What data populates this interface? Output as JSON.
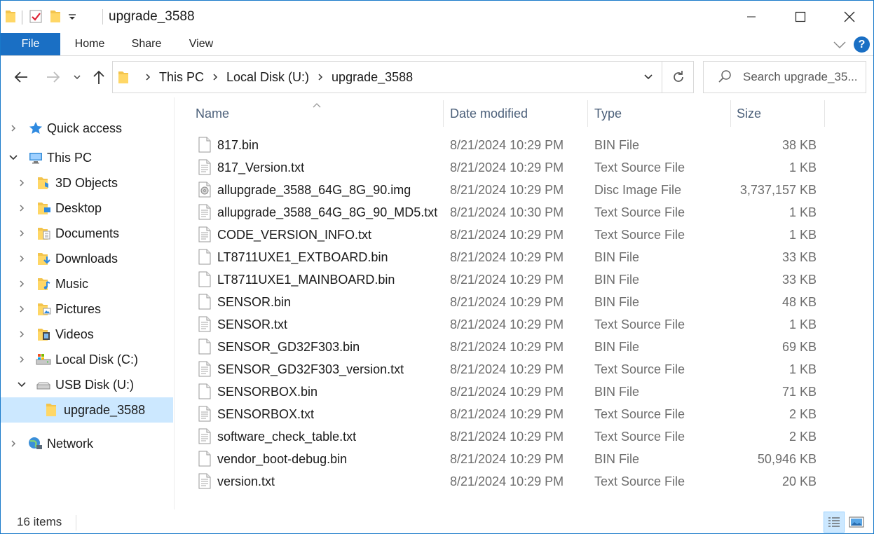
{
  "window": {
    "title": "upgrade_3588",
    "controls": [
      "minimize-icon",
      "maximize-icon",
      "close-icon"
    ]
  },
  "ribbon": {
    "tabs": [
      "File",
      "Home",
      "Share",
      "View"
    ],
    "help_label": "?",
    "accent": "#1a6fc4"
  },
  "address": {
    "breadcrumbs": [
      "This PC",
      "Local Disk (U:)",
      "upgrade_3588"
    ]
  },
  "search": {
    "placeholder": "Search upgrade_35..."
  },
  "sidebar": {
    "items": [
      {
        "label": "Quick access",
        "icon": "star-icon",
        "level": 0,
        "expanded": false
      },
      {
        "label": "This PC",
        "icon": "computer-icon",
        "level": 0,
        "expanded": true
      },
      {
        "label": "3D Objects",
        "icon": "folder-3d-icon",
        "level": 1,
        "expanded": false
      },
      {
        "label": "Desktop",
        "icon": "folder-desktop-icon",
        "level": 1,
        "expanded": false
      },
      {
        "label": "Documents",
        "icon": "folder-documents-icon",
        "level": 1,
        "expanded": false
      },
      {
        "label": "Downloads",
        "icon": "folder-downloads-icon",
        "level": 1,
        "expanded": false
      },
      {
        "label": "Music",
        "icon": "folder-music-icon",
        "level": 1,
        "expanded": false
      },
      {
        "label": "Pictures",
        "icon": "folder-pictures-icon",
        "level": 1,
        "expanded": false
      },
      {
        "label": "Videos",
        "icon": "folder-videos-icon",
        "level": 1,
        "expanded": false
      },
      {
        "label": "Local Disk (C:)",
        "icon": "drive-icon",
        "level": 1,
        "expanded": false
      },
      {
        "label": "USB Disk  (U:)",
        "icon": "usb-drive-icon",
        "level": 1,
        "expanded": true
      },
      {
        "label": "upgrade_3588",
        "icon": "folder-icon",
        "level": 2,
        "selected": true
      },
      {
        "label": "Network",
        "icon": "network-icon",
        "level": 0,
        "expanded": false
      }
    ]
  },
  "columns": [
    "Name",
    "Date modified",
    "Type",
    "Size"
  ],
  "files": [
    {
      "name": "817.bin",
      "date": "8/21/2024 10:29 PM",
      "type": "BIN File",
      "size": "38 KB",
      "icon": "bin-file-icon"
    },
    {
      "name": "817_Version.txt",
      "date": "8/21/2024 10:29 PM",
      "type": "Text Source File",
      "size": "1 KB",
      "icon": "text-file-icon"
    },
    {
      "name": "allupgrade_3588_64G_8G_90.img",
      "date": "8/21/2024 10:29 PM",
      "type": "Disc Image File",
      "size": "3,737,157 KB",
      "icon": "disc-image-icon"
    },
    {
      "name": "allupgrade_3588_64G_8G_90_MD5.txt",
      "date": "8/21/2024 10:30 PM",
      "type": "Text Source File",
      "size": "1 KB",
      "icon": "text-file-icon"
    },
    {
      "name": "CODE_VERSION_INFO.txt",
      "date": "8/21/2024 10:29 PM",
      "type": "Text Source File",
      "size": "1 KB",
      "icon": "text-file-icon"
    },
    {
      "name": "LT8711UXE1_EXTBOARD.bin",
      "date": "8/21/2024 10:29 PM",
      "type": "BIN File",
      "size": "33 KB",
      "icon": "bin-file-icon"
    },
    {
      "name": "LT8711UXE1_MAINBOARD.bin",
      "date": "8/21/2024 10:29 PM",
      "type": "BIN File",
      "size": "33 KB",
      "icon": "bin-file-icon"
    },
    {
      "name": "SENSOR.bin",
      "date": "8/21/2024 10:29 PM",
      "type": "BIN File",
      "size": "48 KB",
      "icon": "bin-file-icon"
    },
    {
      "name": "SENSOR.txt",
      "date": "8/21/2024 10:29 PM",
      "type": "Text Source File",
      "size": "1 KB",
      "icon": "text-file-icon"
    },
    {
      "name": "SENSOR_GD32F303.bin",
      "date": "8/21/2024 10:29 PM",
      "type": "BIN File",
      "size": "69 KB",
      "icon": "bin-file-icon"
    },
    {
      "name": "SENSOR_GD32F303_version.txt",
      "date": "8/21/2024 10:29 PM",
      "type": "Text Source File",
      "size": "1 KB",
      "icon": "text-file-icon"
    },
    {
      "name": "SENSORBOX.bin",
      "date": "8/21/2024 10:29 PM",
      "type": "BIN File",
      "size": "71 KB",
      "icon": "bin-file-icon"
    },
    {
      "name": "SENSORBOX.txt",
      "date": "8/21/2024 10:29 PM",
      "type": "Text Source File",
      "size": "2 KB",
      "icon": "text-file-icon"
    },
    {
      "name": "software_check_table.txt",
      "date": "8/21/2024 10:29 PM",
      "type": "Text Source File",
      "size": "2 KB",
      "icon": "text-file-icon"
    },
    {
      "name": "vendor_boot-debug.bin",
      "date": "8/21/2024 10:29 PM",
      "type": "BIN File",
      "size": "50,946 KB",
      "icon": "bin-file-icon"
    },
    {
      "name": "version.txt",
      "date": "8/21/2024 10:29 PM",
      "type": "Text Source File",
      "size": "20 KB",
      "icon": "text-file-icon"
    }
  ],
  "status": {
    "item_count": "16 items"
  }
}
